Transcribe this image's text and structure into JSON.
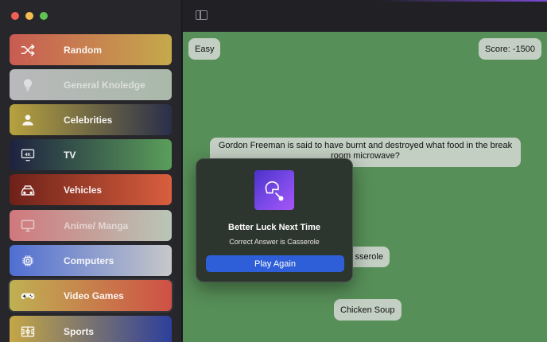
{
  "sidebar": {
    "categories": [
      {
        "label": "Random",
        "icon": "shuffle-icon",
        "gradient": [
          "#c95b52",
          "#c5a94c"
        ]
      },
      {
        "label": "General Knoledge",
        "icon": "lightbulb-icon",
        "gradient": [
          "#b9b9bb",
          "#a9b9a9"
        ],
        "dim": true
      },
      {
        "label": "Celebrities",
        "icon": "person-icon",
        "gradient": [
          "#b7a23f",
          "#2a2f4a"
        ]
      },
      {
        "label": "TV",
        "icon": "tv-4k-icon",
        "gradient": [
          "#1d2140",
          "#5b9e5a"
        ]
      },
      {
        "label": "Vehicles",
        "icon": "car-icon",
        "gradient": [
          "#6e2119",
          "#d85f3e"
        ]
      },
      {
        "label": "Anime/ Manga",
        "icon": "monitor-icon",
        "gradient": [
          "#d0787c",
          "#b9c6b7"
        ],
        "dim": true
      },
      {
        "label": "Computers",
        "icon": "cpu-icon",
        "gradient": [
          "#4f6ed2",
          "#c7c8c9"
        ]
      },
      {
        "label": "Video Games",
        "icon": "gamepad-icon",
        "gradient": [
          "#bfb153",
          "#cf5045"
        ],
        "selected": true
      },
      {
        "label": "Sports",
        "icon": "sports-field-icon",
        "gradient": [
          "#c5a746",
          "#2d3f9c"
        ]
      }
    ]
  },
  "game": {
    "difficulty": "Easy",
    "score": "Score: -1500",
    "question": "Gordon Freeman is said to have burnt and destroyed what food in the break room microwave?",
    "answer_partial": "sserole",
    "answer_soup": "Chicken Soup"
  },
  "modal": {
    "icon": "lightbulb-icon",
    "title": "Better Luck Next Time",
    "subtitle": "Correct Answer is Casserole",
    "button": "Play Again"
  },
  "colors": {
    "main_bg": "#578f58",
    "accent_button": "#2f5fd8"
  }
}
